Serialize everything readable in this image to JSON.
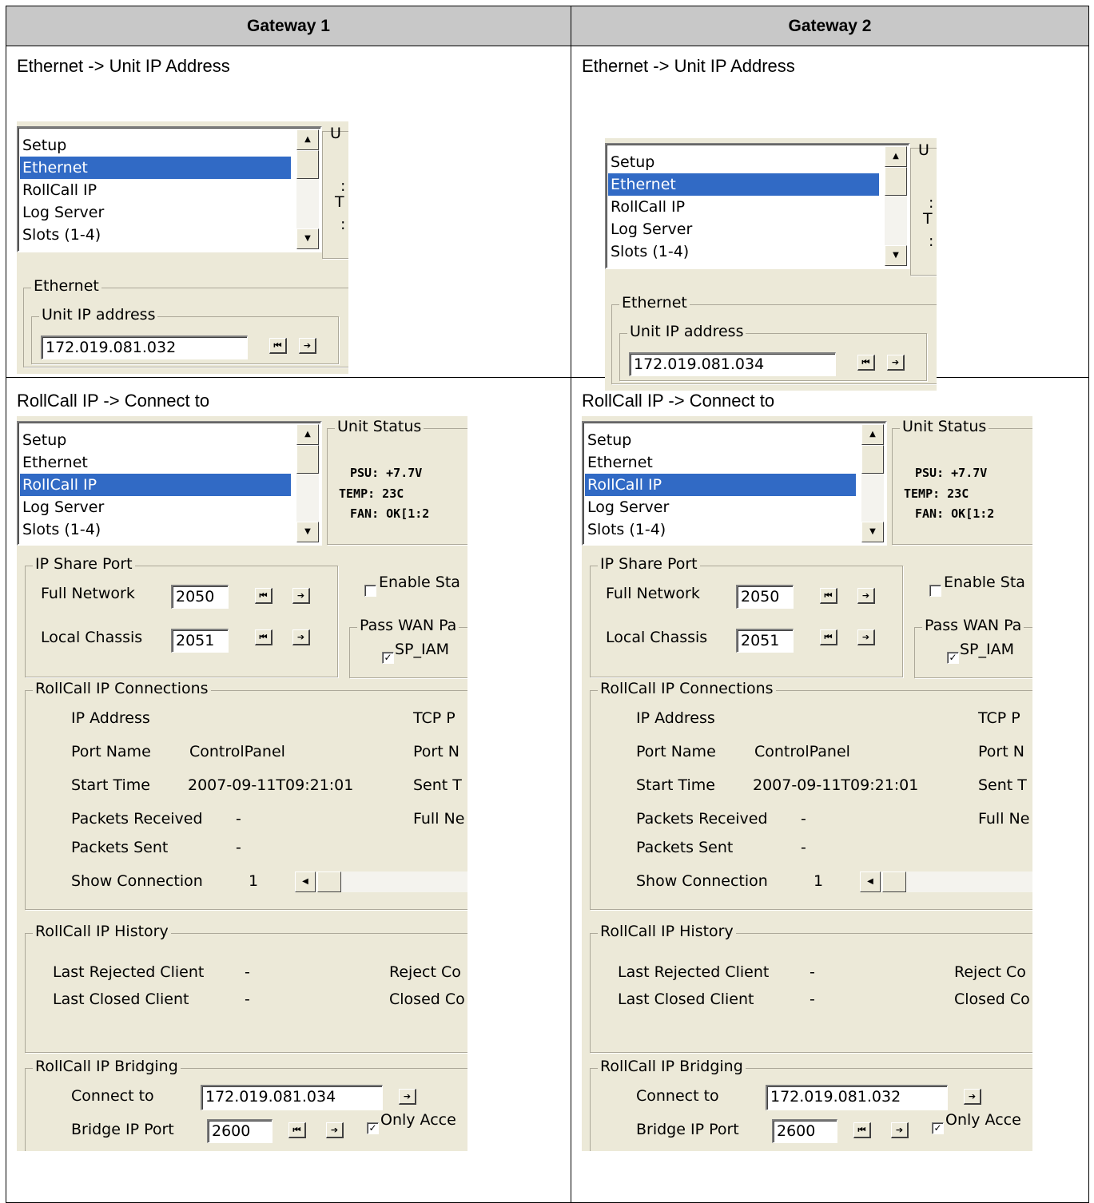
{
  "header": {
    "col1": "Gateway 1",
    "col2": "Gateway 2"
  },
  "section1_title": "Ethernet -> Unit IP Address",
  "section2_title": "RollCall IP -> Connect to",
  "nav_items": [
    "Setup",
    "Ethernet",
    "RollCall IP",
    "Log Server",
    "Slots (1-4)"
  ],
  "eth_nav_items": [
    "Setup",
    "Ethernet",
    "RollCall IP",
    "Log Server",
    "Slots (1-4)"
  ],
  "eth_partial": {
    "u": "U",
    "t": "T",
    "a": ":",
    "b": ":"
  },
  "eth_panel": {
    "group": "Ethernet",
    "subgroup": "Unit IP address"
  },
  "gw1": {
    "unit_ip": "172.019.081.032",
    "connect_to": "172.019.081.034"
  },
  "gw2": {
    "unit_ip": "172.019.081.034",
    "connect_to": "172.019.081.032"
  },
  "unit_status": {
    "title": "Unit Status",
    "psu": "PSU:  +7.7V",
    "temp": "TEMP:   23C",
    "fan": "FAN:  OK[1:2"
  },
  "ip_share": {
    "group": "IP Share Port",
    "full_network_label": "Full Network",
    "full_network_value": "2050",
    "local_chassis_label": "Local Chassis",
    "local_chassis_value": "2051",
    "enable_label": "Enable Sta",
    "pass_wan_label": "Pass WAN Pa",
    "sp_iam_label": "SP_IAM"
  },
  "connections": {
    "group": "RollCall IP Connections",
    "ip_address": "IP Address",
    "tcp": "TCP P",
    "port_name": "Port Name",
    "port_name_value": "ControlPanel",
    "port_n": "Port N",
    "start_time": "Start Time",
    "start_time_value": "2007-09-11T09:21:01",
    "sent_t": "Sent T",
    "packets_received": "Packets Received",
    "packets_received_value": "-",
    "full_ne": "Full Ne",
    "packets_sent": "Packets Sent",
    "packets_sent_value": "-",
    "show_connection": "Show Connection",
    "show_connection_value": "1"
  },
  "history": {
    "group": "RollCall IP History",
    "last_rejected": "Last Rejected Client",
    "last_rejected_value": "-",
    "reject_c": "Reject Co",
    "last_closed": "Last Closed Client",
    "last_closed_value": "-",
    "closed_c": "Closed Co"
  },
  "bridging": {
    "group": "RollCall IP Bridging",
    "connect_to_label": "Connect to",
    "bridge_port_label": "Bridge IP Port",
    "bridge_port_value": "2600",
    "only_acce": "Only Acce"
  },
  "icons": {
    "first": "first-last-icon",
    "next": "arrow-right-icon"
  }
}
